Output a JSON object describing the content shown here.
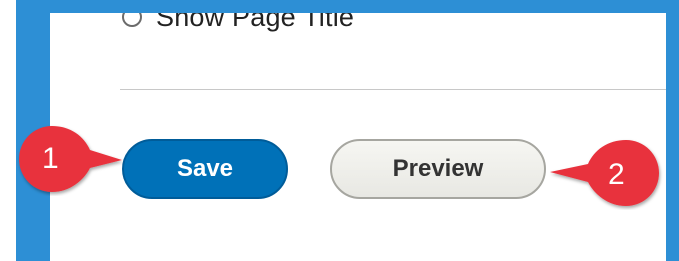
{
  "form": {
    "radio_label": "Show Page Title",
    "save_label": "Save",
    "preview_label": "Preview"
  },
  "callouts": [
    {
      "number": "1",
      "color": "#e8323c"
    },
    {
      "number": "2",
      "color": "#e8323c"
    }
  ],
  "colors": {
    "frame": "#2d8fd5",
    "save_button": "#0071b8",
    "preview_button": "#eeeeea"
  }
}
